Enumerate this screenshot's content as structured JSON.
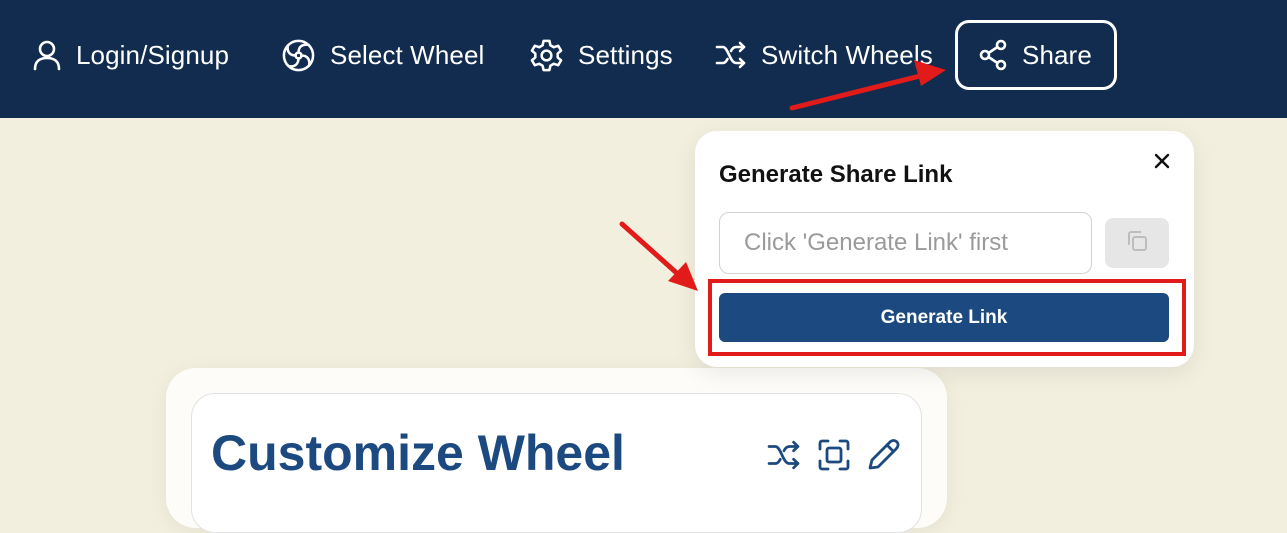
{
  "navbar": {
    "login_label": "Login/Signup",
    "select_wheel_label": "Select Wheel",
    "settings_label": "Settings",
    "switch_wheels_label": "Switch Wheels",
    "share_label": "Share"
  },
  "share_popover": {
    "title": "Generate Share Link",
    "link_placeholder": "Click 'Generate Link' first",
    "generate_button_label": "Generate Link"
  },
  "customize_card": {
    "title": "Customize Wheel"
  },
  "colors": {
    "navbar_bg": "#112c4e",
    "accent": "#1c4a80",
    "annotation_red": "#e11a1a",
    "page_bg": "#f3efdf"
  },
  "icons": [
    "user-icon",
    "wheel-icon",
    "gear-icon",
    "shuffle-icon",
    "share-icon",
    "close-icon",
    "copy-icon",
    "fullscreen-icon",
    "pencil-icon"
  ]
}
